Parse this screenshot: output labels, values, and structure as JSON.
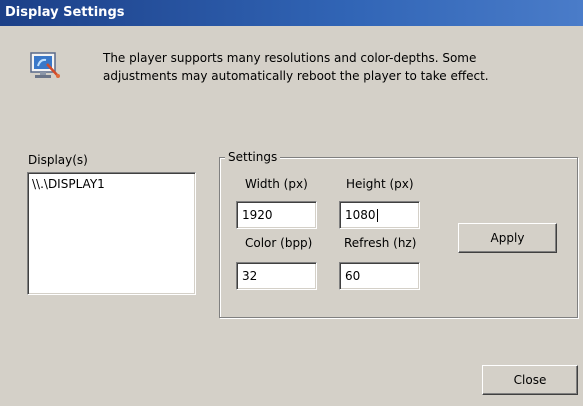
{
  "window": {
    "title": "Display Settings"
  },
  "info": {
    "icon": "display-settings-icon",
    "line1": "The player supports many resolutions and color-depths.  Some",
    "line2": "adjustments may automatically reboot the player to take effect."
  },
  "displays": {
    "label": "Display(s)",
    "items": [
      "\\\\.\\DISPLAY1"
    ]
  },
  "settings": {
    "legend": "Settings",
    "width_label": "Width (px)",
    "width_value": "1920",
    "height_label": "Height (px)",
    "height_value": "1080",
    "color_label": "Color (bpp)",
    "color_value": "32",
    "refresh_label": "Refresh (hz)",
    "refresh_value": "60",
    "apply_label": "Apply"
  },
  "footer": {
    "close_label": "Close"
  }
}
